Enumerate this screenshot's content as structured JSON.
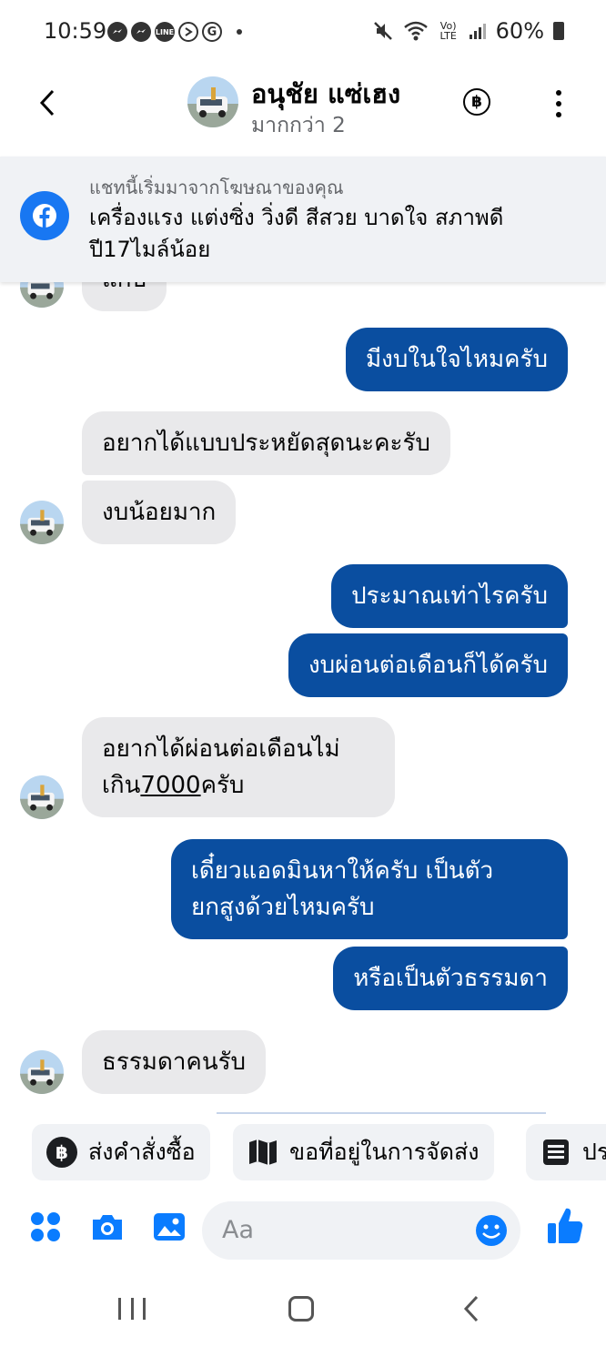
{
  "status_bar": {
    "time": "10:59",
    "network": "Vo) LTE",
    "battery": "60%",
    "icons": [
      "messenger-icon",
      "messenger-icon",
      "line-icon",
      "play-icon",
      "google-icon",
      "dot-icon",
      "mute-icon",
      "wifi-icon",
      "signal-icon",
      "battery-icon"
    ]
  },
  "header": {
    "contact_name": "อนุชัย แซ่เฮง",
    "subtitle": "มากกว่า 2",
    "baht_symbol": "฿"
  },
  "ad_banner": {
    "label": "แชทนี้เริ่มมาจากโฆษณาของคุณ",
    "text": "เครื่องแรง แต่งซิ่ง วิ่งดี สีสวย บาดใจ สภาพดี ปี17ไมล์น้อย"
  },
  "messages": [
    {
      "direction": "in",
      "text": "แก้บ"
    },
    {
      "direction": "out",
      "text": "มีงบในใจไหมครับ"
    },
    {
      "direction": "in",
      "text": "อยากได้แบบประหยัดสุดนะคะรับ"
    },
    {
      "direction": "in",
      "text": "งบน้อยมาก"
    },
    {
      "direction": "out",
      "text": "ประมาณเท่าไรครับ"
    },
    {
      "direction": "out",
      "text": "งบผ่อนต่อเดือนก็ได้ครับ"
    },
    {
      "direction": "in",
      "text_line1": "อยากได้ผ่อนต่อเดือนไม่",
      "text_line2_pre": "เกิน",
      "text_line2_link": "7000",
      "text_line2_post": "ครับ"
    },
    {
      "direction": "out",
      "text_line1": "เดี๋ยวแอดมินหาให้ครับ เป็นตัว",
      "text_line2": "ยกสูงด้วยไหมครับ"
    },
    {
      "direction": "out",
      "text": "หรือเป็นตัวธรรมดา"
    },
    {
      "direction": "in",
      "text": "ธรรมดาคนรับ"
    }
  ],
  "quick_replies": [
    {
      "label": "ส่งคำสั่งซื้อ",
      "icon": "baht-icon"
    },
    {
      "label": "ขอที่อยู่ในการจัดส่ง",
      "icon": "map-icon"
    },
    {
      "label": "ปร",
      "icon": "receipt-icon"
    }
  ],
  "composer": {
    "placeholder": "Aa"
  },
  "colors": {
    "outgoing_bubble": "#0a4ea0",
    "incoming_bubble": "#e9e9eb",
    "messenger_blue": "#1877f2"
  }
}
